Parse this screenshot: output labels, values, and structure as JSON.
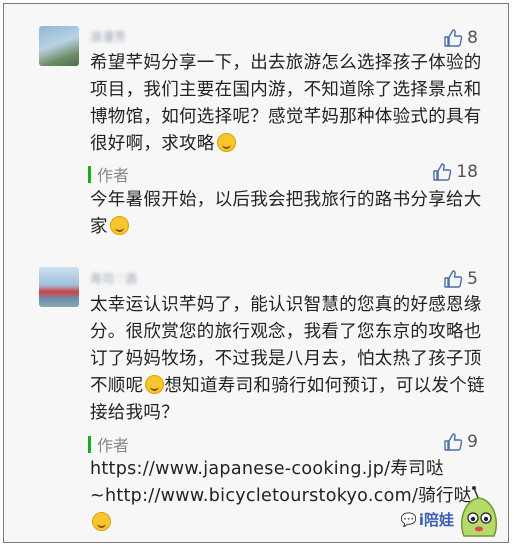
{
  "comments": [
    {
      "username": "浪漫芳",
      "likes": "8",
      "text": "希望芊妈分享一下，出去旅游怎么选择孩子体验的项目，我们主要在国内游，不知道除了选择景点和博物馆，如何选择呢？感觉芊妈那种体验式的具有很好啊，求攻略",
      "reply": {
        "label": "作者",
        "likes": "18",
        "text": "今年暑假开始，以后我会把我旅行的路书分享给大家"
      }
    },
    {
      "username": "寿司♡酒",
      "likes": "5",
      "text_1": "太幸运认识芊妈了，能认识智慧的您真的好感恩缘分。很欣赏您的旅行观念，我看了您东京的攻略也订了妈妈牧场，不过我是八月去，怕太热了孩子顶不顺呢",
      "text_2": "想知道寿司和骑行如何预订，可以发个链接给我吗？",
      "reply": {
        "label": "作者",
        "likes": "9",
        "text_1": "https://www.japanese-cooking.jp/寿司哒",
        "text_2": "~http://www.bicycletourstokyo.com/骑行哒"
      }
    }
  ],
  "watermark": {
    "text": "i陪娃"
  },
  "icons": {
    "like": "thumbs-up-icon",
    "emoji_smile": "smile-emoji-icon",
    "emoji_grin": "grin-emoji-icon",
    "emoji_think": "thinking-emoji-icon"
  }
}
